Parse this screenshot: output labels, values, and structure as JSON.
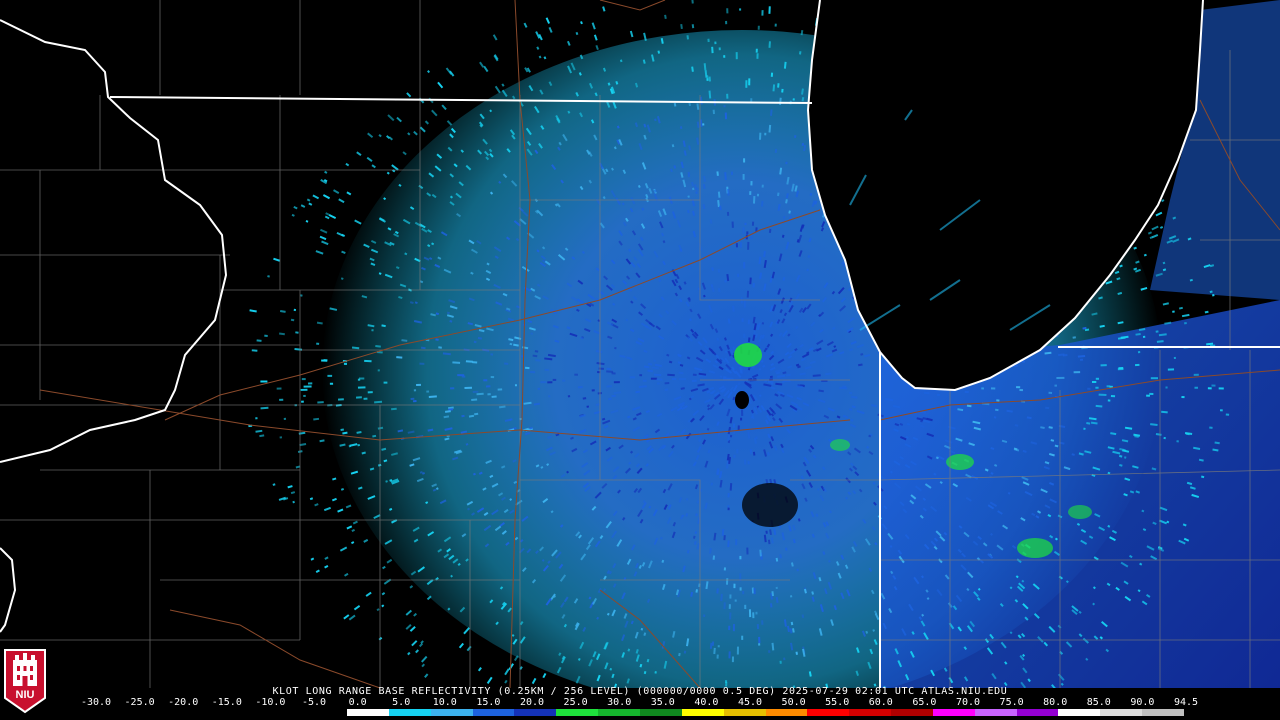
{
  "caption": "KLOT LONG RANGE BASE REFLECTIVITY (0.25KM / 256 LEVEL) (000000/0000 0.5 DEG) 2025-07-29 02:01 UTC  ATLAS.NIU.EDU",
  "logo": {
    "text": "NIU",
    "color": "#c8102e"
  },
  "scale": {
    "labels": [
      "-30.0",
      "-25.0",
      "-20.0",
      "-15.0",
      "-10.0",
      "-5.0",
      "0.0",
      "5.0",
      "10.0",
      "15.0",
      "20.0",
      "25.0",
      "30.0",
      "35.0",
      "40.0",
      "45.0",
      "50.0",
      "55.0",
      "60.0",
      "65.0",
      "70.0",
      "75.0",
      "80.0",
      "85.0",
      "90.0",
      "94.5"
    ],
    "colors": [
      "#000000",
      "#000000",
      "#000000",
      "#000000",
      "#000000",
      "#000000",
      "#ffffff",
      "#16d3f2",
      "#3cb2ee",
      "#1d63de",
      "#1432b8",
      "#1ee23c",
      "#15b52d",
      "#10891f",
      "#ffff00",
      "#e6c000",
      "#ff8c00",
      "#ff0000",
      "#d40000",
      "#b00000",
      "#ff00ff",
      "#c864ff",
      "#9400d3",
      "#ffffff",
      "#dcdcdc",
      "#c0c0c0"
    ]
  },
  "radar": {
    "site": "KLOT",
    "echo_colors": [
      "#16d3f2",
      "#3cb2ee",
      "#1d63de",
      "#1432b8",
      "#1ee23c"
    ]
  },
  "map": {
    "water_color": "#000000",
    "state_line_color": "#ffffff",
    "county_line_color": "#7a7a7a",
    "highway_color": "#8b4a2b"
  }
}
